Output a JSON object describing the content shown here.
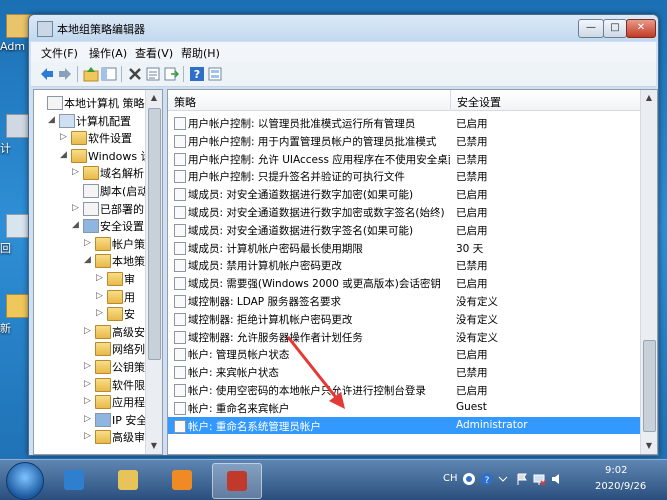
{
  "desktop": {
    "icons": [
      {
        "label": "Adm",
        "icon": "user-folder-icon",
        "color": "#e9c46a"
      },
      {
        "label": "计",
        "icon": "computer-icon",
        "color": "#cfd8e3"
      },
      {
        "label": "回",
        "icon": "recycle-bin-icon",
        "color": "#d8e4ee"
      },
      {
        "label": "新",
        "icon": "folder-icon",
        "color": "#f0c75a"
      }
    ]
  },
  "window": {
    "title": "本地组策略编辑器",
    "controls": {
      "minimize": "—",
      "maximize": "□",
      "close": "✕"
    }
  },
  "menu": [
    "文件(F)",
    "操作(A)",
    "查看(V)",
    "帮助(H)"
  ],
  "toolbar": [
    "back-icon",
    "forward-icon",
    "up-icon",
    "show-hide-tree-icon",
    "delete-icon",
    "properties-icon",
    "export-icon",
    "help-icon",
    "view-icon"
  ],
  "tree": [
    {
      "label": "本地计算机 策略",
      "level": 0,
      "expander": "",
      "icon": "policy"
    },
    {
      "label": "计算机配置",
      "level": 1,
      "expander": "◢",
      "icon": "computer"
    },
    {
      "label": "软件设置",
      "level": 2,
      "expander": "▷",
      "icon": "folder"
    },
    {
      "label": "Windows 设",
      "level": 2,
      "expander": "◢",
      "icon": "folder"
    },
    {
      "label": "域名解析",
      "level": 3,
      "expander": "▷",
      "icon": "folder"
    },
    {
      "label": "脚本(启动",
      "level": 3,
      "expander": "",
      "icon": "policy"
    },
    {
      "label": "已部署的",
      "level": 3,
      "expander": "▷",
      "icon": "policy"
    },
    {
      "label": "安全设置",
      "level": 3,
      "expander": "◢",
      "icon": "shield"
    },
    {
      "label": "帐户策",
      "level": 4,
      "expander": "▷",
      "icon": "folder"
    },
    {
      "label": "本地策",
      "level": 4,
      "expander": "◢",
      "icon": "folder"
    },
    {
      "label": "审",
      "level": 5,
      "expander": "▷",
      "icon": "folder"
    },
    {
      "label": "用",
      "level": 5,
      "expander": "▷",
      "icon": "folder"
    },
    {
      "label": "安",
      "level": 5,
      "expander": "▷",
      "icon": "folder"
    },
    {
      "label": "高级安",
      "level": 4,
      "expander": "▷",
      "icon": "folder"
    },
    {
      "label": "网络列",
      "level": 4,
      "expander": "",
      "icon": "folder"
    },
    {
      "label": "公钥策",
      "level": 4,
      "expander": "▷",
      "icon": "folder"
    },
    {
      "label": "软件限",
      "level": 4,
      "expander": "▷",
      "icon": "folder"
    },
    {
      "label": "应用程",
      "level": 4,
      "expander": "▷",
      "icon": "folder"
    },
    {
      "label": "IP 安全",
      "level": 4,
      "expander": "▷",
      "icon": "shield"
    },
    {
      "label": "高级审",
      "level": 4,
      "expander": "▷",
      "icon": "folder"
    }
  ],
  "list": {
    "headers": {
      "name": "策略",
      "value": "安全设置"
    },
    "rows": [
      {
        "name": "用户帐户控制: 以管理员批准模式运行所有管理员",
        "value": "已启用"
      },
      {
        "name": "用户帐户控制: 用于内置管理员帐户的管理员批准模式",
        "value": "已禁用"
      },
      {
        "name": "用户帐户控制: 允许 UIAccess 应用程序在不使用安全桌面...",
        "value": "已禁用"
      },
      {
        "name": "用户帐户控制: 只提升签名并验证的可执行文件",
        "value": "已禁用"
      },
      {
        "name": "域成员: 对安全通道数据进行数字加密(如果可能)",
        "value": "已启用"
      },
      {
        "name": "域成员: 对安全通道数据进行数字加密或数字签名(始终)",
        "value": "已启用"
      },
      {
        "name": "域成员: 对安全通道数据进行数字签名(如果可能)",
        "value": "已启用"
      },
      {
        "name": "域成员: 计算机帐户密码最长使用期限",
        "value": "30 天"
      },
      {
        "name": "域成员: 禁用计算机帐户密码更改",
        "value": "已禁用"
      },
      {
        "name": "域成员: 需要强(Windows 2000 或更高版本)会话密钥",
        "value": "已启用"
      },
      {
        "name": "域控制器: LDAP 服务器签名要求",
        "value": "没有定义"
      },
      {
        "name": "域控制器: 拒绝计算机帐户密码更改",
        "value": "没有定义"
      },
      {
        "name": "域控制器: 允许服务器操作者计划任务",
        "value": "没有定义"
      },
      {
        "name": "帐户: 管理员帐户状态",
        "value": "已启用"
      },
      {
        "name": "帐户: 来宾帐户状态",
        "value": "已禁用"
      },
      {
        "name": "帐户: 使用空密码的本地帐户只允许进行控制台登录",
        "value": "已启用"
      },
      {
        "name": "帐户: 重命名来宾帐户",
        "value": "Guest"
      },
      {
        "name": "帐户: 重命名系统管理员帐户",
        "value": "Administrator",
        "selected": true
      }
    ]
  },
  "taskbar": {
    "items": [
      {
        "icon": "ie-icon",
        "color": "#2f7fd1"
      },
      {
        "icon": "explorer-icon",
        "color": "#e8c25a"
      },
      {
        "icon": "media-player-icon",
        "color": "#f08a24"
      },
      {
        "icon": "toolbox-icon",
        "color": "#c0392b",
        "active": true
      }
    ],
    "lang": "CH",
    "time": "9:02",
    "date": "2020/9/26"
  },
  "colors": {
    "selection": "#3399ff",
    "annotation_arrow": "#e53935"
  }
}
